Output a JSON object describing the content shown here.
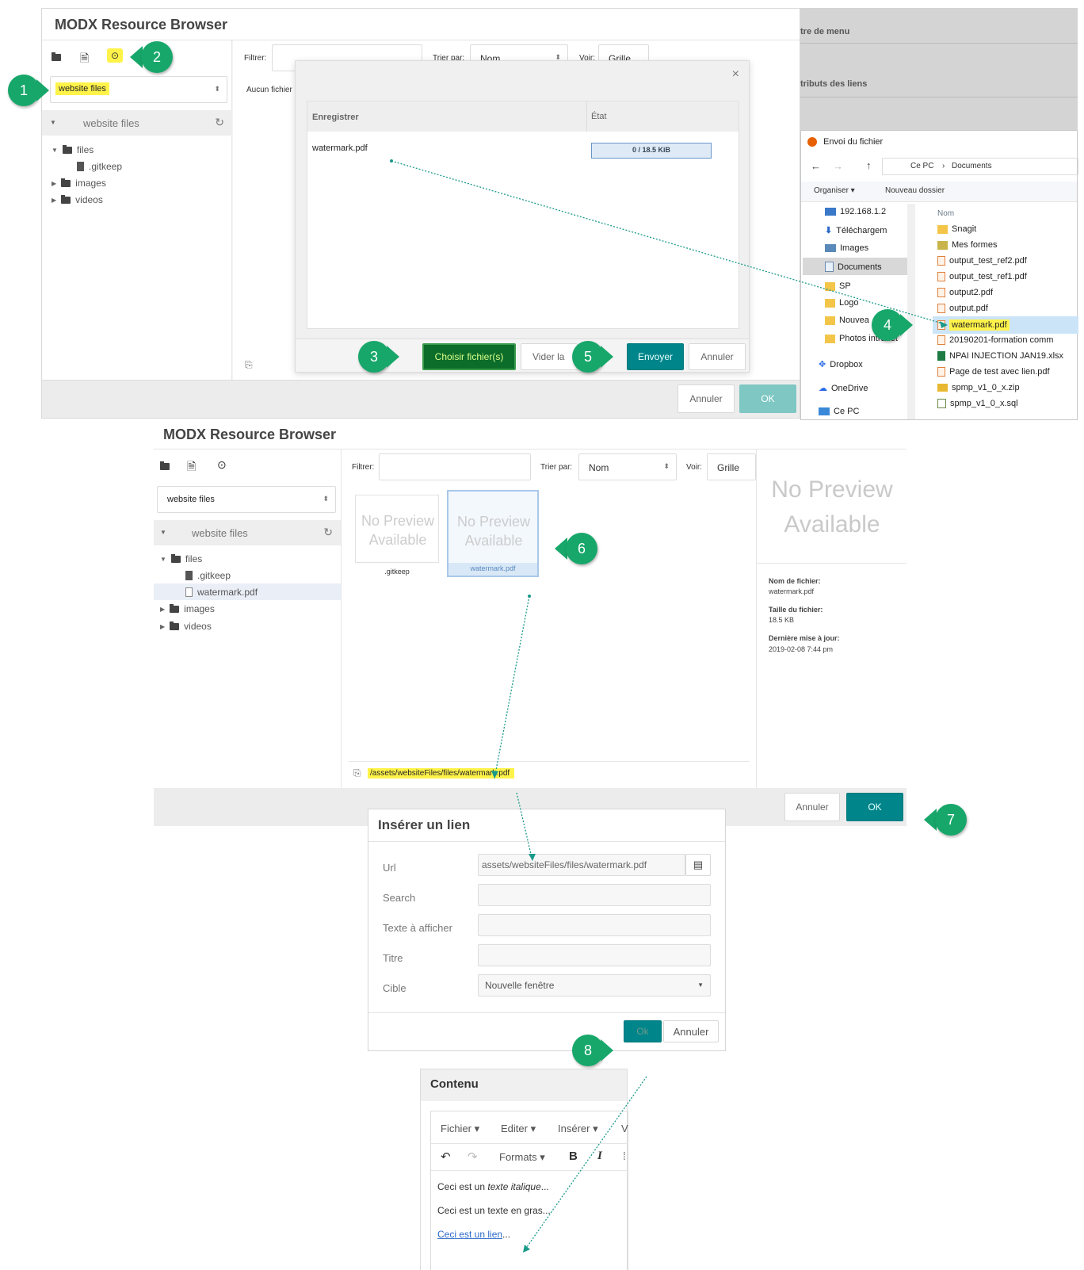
{
  "browser1": {
    "title": "MODX Resource Browser",
    "source_select": "website files",
    "tree_header": "website files",
    "tree": [
      "files",
      ".gitkeep",
      "images",
      "videos"
    ],
    "filter_label": "Filtrer:",
    "sort_label": "Trier par:",
    "sort_value": "Nom",
    "view_label": "Voir:",
    "view_value": "Grille",
    "no_file_text": "Aucun fichier",
    "btn_cancel": "Annuler",
    "btn_ok": "OK"
  },
  "upload": {
    "close": "×",
    "col_file": "Enregistrer",
    "col_state": "État",
    "file_name": "watermark.pdf",
    "progress_text": "0 / 18.5 KiB",
    "progress_fraction": 0,
    "btn_choose": "Choisir fichier(s)",
    "btn_clear": "Vider la",
    "btn_send": "Envoyer",
    "btn_cancel": "Annuler"
  },
  "right_menu": [
    "tre de menu",
    "tributs des liens"
  ],
  "file_dialog": {
    "title": "Envoi du fichier",
    "path": [
      "Ce PC",
      "Documents"
    ],
    "organize": "Organiser ▾",
    "new_folder": "Nouveau dossier",
    "col_name": "Nom",
    "nav_items": [
      "192.168.1.2",
      "Téléchargem",
      "Images",
      "Documents",
      "SP",
      "Logo",
      "Nouvea",
      "Photos intranet",
      "Dropbox",
      "OneDrive",
      "Ce PC"
    ],
    "files": [
      "Snagit",
      "Mes formes",
      "output_test_ref2.pdf",
      "output_test_ref1.pdf",
      "output2.pdf",
      "output.pdf",
      "watermark.pdf",
      "20190201-formation comm",
      "NPAI INJECTION JAN19.xlsx",
      "Page de test avec lien.pdf",
      "spmp_v1_0_x.zip",
      "spmp_v1_0_x.sql"
    ]
  },
  "browser2": {
    "title": "MODX Resource Browser",
    "source_select": "website files",
    "tree_header": "website files",
    "tree": [
      "files",
      ".gitkeep",
      "watermark.pdf",
      "images",
      "videos"
    ],
    "filter_label": "Filtrer:",
    "sort_label": "Trier par:",
    "sort_value": "Nom",
    "view_label": "Voir:",
    "view_value": "Grille",
    "thumb_text": "No Preview Available",
    "thumb1_name": ".gitkeep",
    "thumb2_name": "watermark.pdf",
    "preview_text": "No Preview Available",
    "info_name_label": "Nom de fichier:",
    "info_name_value": "watermark.pdf",
    "info_size_label": "Taille du fichier:",
    "info_size_value": "18.5 KB",
    "info_date_label": "Dernière mise à jour:",
    "info_date_value": "2019-02-08 7:44 pm",
    "path": "/assets/websiteFiles/files/watermark.pdf",
    "btn_cancel": "Annuler",
    "btn_ok": "OK"
  },
  "link_dialog": {
    "title": "Insérer un lien",
    "url_label": "Url",
    "url_value": "assets/websiteFiles/files/watermark.pdf",
    "search_label": "Search",
    "text_label": "Texte à afficher",
    "title_label": "Titre",
    "target_label": "Cible",
    "target_value": "Nouvelle fenêtre",
    "btn_ok": "Ok",
    "btn_cancel": "Annuler"
  },
  "editor": {
    "title": "Contenu",
    "menu": [
      "Fichier ▾",
      "Editer ▾",
      "Insérer ▾",
      "V"
    ],
    "formats": "Formats ▾",
    "bold": "B",
    "italic": "I",
    "line1_a": "Ceci est un ",
    "line1_b": "texte italique",
    "line1_c": "...",
    "line2_a": "Ceci est un texte ",
    "line2_b": "en gras",
    "line2_c": "...",
    "line3_a": "Ceci est un lien",
    "line3_c": "..."
  },
  "steps": [
    "1",
    "2",
    "3",
    "4",
    "5",
    "6",
    "7",
    "8"
  ],
  "colors": {
    "badge": "#17a76a",
    "teal": "#00858a",
    "highlight": "#fff34a",
    "arrow": "#1a9a8a"
  }
}
